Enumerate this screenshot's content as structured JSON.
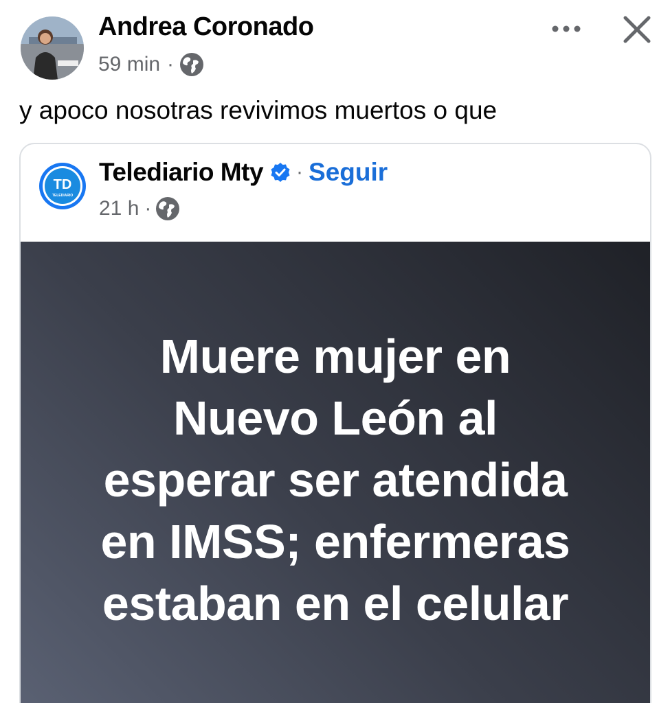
{
  "post": {
    "author_name": "Andrea Coronado",
    "time": "59 min",
    "separator": "·",
    "privacy_icon": "globe-icon",
    "text": "y apoco nosotras revivimos muertos o que"
  },
  "actions": {
    "more_icon": "more-dots-icon",
    "close_icon": "close-icon"
  },
  "shared": {
    "page_name": "Telediario Mty",
    "verified_icon": "verified-badge-icon",
    "separator": "·",
    "follow_label": "Seguir",
    "time": "21 h",
    "privacy_icon": "globe-icon",
    "logo_text": "TD",
    "logo_subtext": "TELEDIARIO",
    "headline_lines": [
      "Muere mujer en",
      "Nuevo León al",
      "esperar ser atendida",
      "en IMSS; enfermeras",
      "estaban en el celular"
    ]
  },
  "colors": {
    "link_blue": "#1a6ed8",
    "meta_gray": "#65676b",
    "panel_dark": "#1f2127",
    "panel_light": "#5b6274"
  }
}
